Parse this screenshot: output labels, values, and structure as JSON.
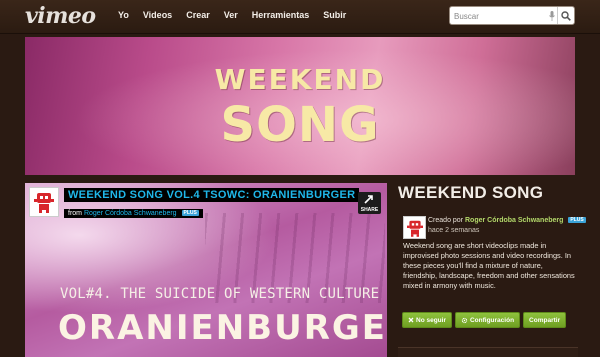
{
  "header": {
    "logo": "vimeo",
    "nav": [
      "Yo",
      "Videos",
      "Crear",
      "Ver",
      "Herramientas",
      "Subir"
    ],
    "search_placeholder": "Buscar"
  },
  "banner": {
    "line1": "WEEKEND",
    "line2": "SONG"
  },
  "video": {
    "title": "WEEKEND SONG VOL.4 TSOWC: ORANIENBURGER",
    "from_label": "from",
    "author": "Roger Córdoba Schwaneberg",
    "plus_badge": "PLUS",
    "share_label": "SHARE",
    "subtitle": "VOL#4. THE SUICIDE OF WESTERN CULTURE",
    "big_title": "ORANIENBURGER"
  },
  "channel": {
    "title": "WEEKEND SONG",
    "created_by": "Creado por",
    "owner": "Roger Córdoba Schwaneberg",
    "plus_badge": "PLUS",
    "time_ago": "hace 2 semanas",
    "description": "Weekend song are short videoclips made in improvised photo sessions and video recordings. In these pieces you'll find a mixture of nature, friendship, landscape, freedom and other sensations mixed in armony with music.",
    "buttons": {
      "unfollow": "No seguir",
      "settings": "Configuración",
      "share": "Compartir"
    }
  },
  "colors": {
    "background": "#2a1a12",
    "accent_green": "#8ec23d",
    "link_blue": "#1fb7e9",
    "title_cream": "#f7e9a6"
  }
}
